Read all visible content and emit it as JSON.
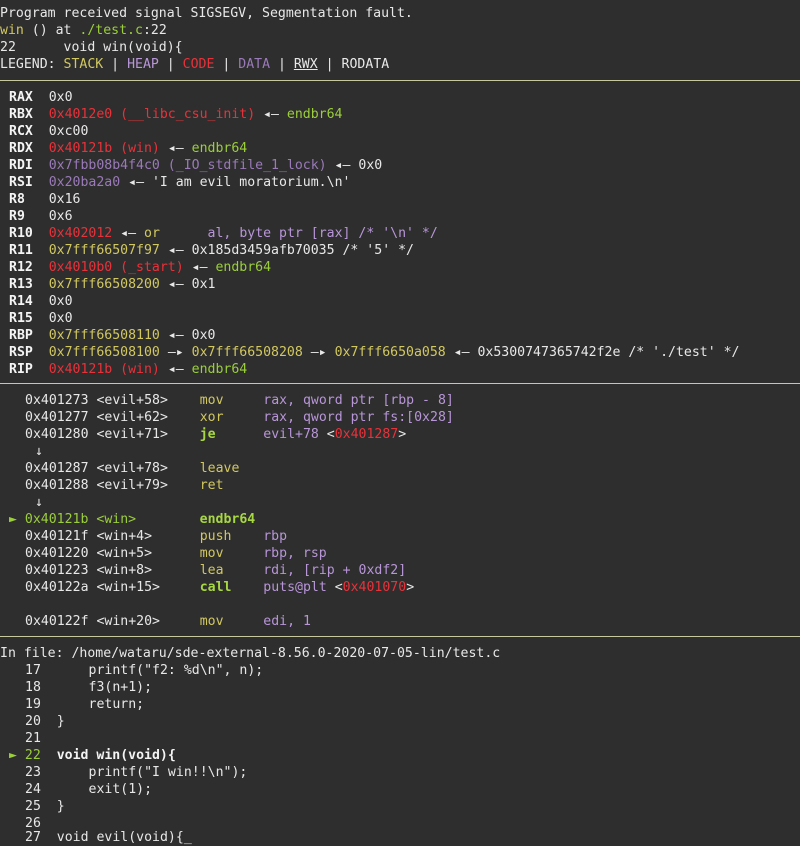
{
  "header": {
    "signal_msg": "Program received signal SIGSEGV, Segmentation fault.",
    "frame_fn": "win",
    "frame_mid": " () at ",
    "frame_file": "./test.c",
    "frame_line": ":22",
    "src_lineno": "22",
    "src_text": "      void win(void){",
    "legend_prefix": "LEGEND: ",
    "legend_stack": "STACK",
    "legend_heap": "HEAP",
    "legend_code": "CODE",
    "legend_data": "DATA",
    "legend_rwx": "RWX",
    "legend_rodata": "RODATA",
    "legend_sep": " | "
  },
  "registers": {
    "rax_name": "RAX",
    "rax_val": "0x0",
    "rbx_name": "RBX",
    "rbx_val": "0x4012e0 (__libc_csu_init)",
    "rbx_arrow": " ◂— ",
    "rbx_deref": "endbr64",
    "rcx_name": "RCX",
    "rcx_val": "0xc00",
    "rdx_name": "RDX",
    "rdx_val": "0x40121b (win)",
    "rdx_arrow": " ◂— ",
    "rdx_deref": "endbr64",
    "rdi_name": "RDI",
    "rdi_val": "0x7fbb08b4f4c0 (_IO_stdfile_1_lock)",
    "rdi_arrow": " ◂— ",
    "rdi_deref": "0x0",
    "rsi_name": "RSI",
    "rsi_val": "0x20ba2a0",
    "rsi_arrow": " ◂— ",
    "rsi_deref": "'I am evil moratorium.\\n'",
    "r8_name": "R8",
    "r8_val": "0x16",
    "r9_name": "R9",
    "r9_val": "0x6",
    "r10_name": "R10",
    "r10_val": "0x402012",
    "r10_arrow": " ◂— ",
    "r10_ins": "or",
    "r10_ops_a": "      al, ",
    "r10_ops_b": "byte ptr",
    "r10_ops_c": " [rax] /* '\\n' */",
    "r11_name": "R11",
    "r11_val": "0x7fff66507f97",
    "r11_arrow": " ◂— ",
    "r11_deref": "0x185d3459afb70035 /* '5' */",
    "r12_name": "R12",
    "r12_val": "0x4010b0 (_start)",
    "r12_arrow": " ◂— ",
    "r12_deref": "endbr64",
    "r13_name": "R13",
    "r13_val": "0x7fff66508200",
    "r13_arrow": " ◂— ",
    "r13_deref": "0x1",
    "r14_name": "R14",
    "r14_val": "0x0",
    "r15_name": "R15",
    "r15_val": "0x0",
    "rbp_name": "RBP",
    "rbp_val": "0x7fff66508110",
    "rbp_arrow": " ◂— ",
    "rbp_deref": "0x0",
    "rsp_name": "RSP",
    "rsp_val": "0x7fff66508100",
    "rsp_arrow1": " —▸ ",
    "rsp_val2": "0x7fff66508208",
    "rsp_arrow2": " —▸ ",
    "rsp_val3": "0x7fff6650a058",
    "rsp_arrow3": " ◂— ",
    "rsp_deref": "0x5300747365742f2e /* './test' */",
    "rip_name": "RIP",
    "rip_val": "0x40121b (win)",
    "rip_arrow": " ◂— ",
    "rip_deref": "endbr64"
  },
  "disasm": [
    {
      "addr": "0x401273",
      "sym": "<evil+58>",
      "op": "mov",
      "args_a": "rax, ",
      "args_b": "qword ptr",
      "args_c": " [rbp - 8]"
    },
    {
      "addr": "0x401277",
      "sym": "<evil+62>",
      "op": "xor",
      "args_a": "rax, ",
      "args_b": "qword ptr",
      "args_c": " fs:[0x28]"
    },
    {
      "addr": "0x401280",
      "sym": "<evil+71>",
      "op": "je",
      "args_a": "evil+78",
      "args_b": " <",
      "args_c": "0x401287",
      "args_d": ">"
    },
    {
      "addr": "0x401287",
      "sym": "<evil+78>",
      "op": "leave"
    },
    {
      "addr": "0x401288",
      "sym": "<evil+79>",
      "op": "ret"
    },
    {
      "addr": "0x40121b",
      "sym": "<win>",
      "op": "endbr64"
    },
    {
      "addr": "0x40121f",
      "sym": "<win+4>",
      "op": "push",
      "args_a": "rbp"
    },
    {
      "addr": "0x401220",
      "sym": "<win+5>",
      "op": "mov",
      "args_a": "rbp, rsp"
    },
    {
      "addr": "0x401223",
      "sym": "<win+8>",
      "op": "lea",
      "args_a": "rdi, ",
      "args_b": "[rip + ",
      "args_c": "0xdf2",
      "args_d": "]"
    },
    {
      "addr": "0x40122a",
      "sym": "<win+15>",
      "op": "call",
      "args_a": "puts@plt",
      "args_b": " <",
      "args_c": "0x401070",
      "args_d": ">"
    },
    {
      "addr": "0x40122f",
      "sym": "<win+20>",
      "op": "mov",
      "args_a": "edi, ",
      "args_b": "1"
    }
  ],
  "disasm_arrow": "↓",
  "current_marker": "►",
  "source": {
    "in_file_label": "In file: ",
    "in_file_path": "/home/wataru/sde-external-8.56.0-2020-07-05-lin/test.c",
    "lines": [
      {
        "no": "17",
        "text": "    printf(\"f2: %d\\n\", n);"
      },
      {
        "no": "18",
        "text": "    f3(n+1);"
      },
      {
        "no": "19",
        "text": "    return;"
      },
      {
        "no": "20",
        "text": "}"
      },
      {
        "no": "21",
        "text": ""
      },
      {
        "no": "22",
        "text": "void win(void){"
      },
      {
        "no": "23",
        "text": "    printf(\"I win!!\\n\");"
      },
      {
        "no": "24",
        "text": "    exit(1);"
      },
      {
        "no": "25",
        "text": "}"
      },
      {
        "no": "26",
        "text": ""
      },
      {
        "no": "27",
        "text": "void evil(void){"
      }
    ],
    "cursor": "_"
  }
}
